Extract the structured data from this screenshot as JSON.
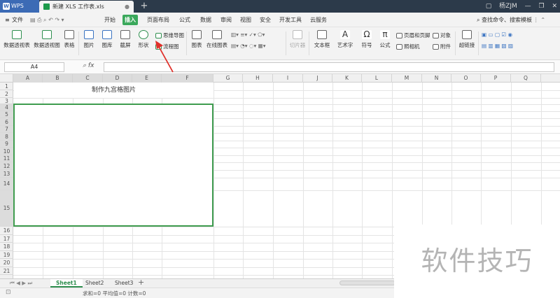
{
  "tabs": {
    "app_name": "WPS",
    "document_title": "新建 XLS 工作表.xls",
    "new_tab": "+"
  },
  "menu": {
    "file": "文件",
    "items": [
      "开始",
      "插入",
      "页面布局",
      "公式",
      "数据",
      "审阅",
      "视图",
      "安全",
      "开发工具",
      "云服务"
    ],
    "active_index": 1,
    "search": "查找命令、搜索模板",
    "user": "杨ZJM"
  },
  "ribbon": {
    "pivot_table": "数据透视表",
    "pivot_chart": "数据透视图",
    "table": "表格",
    "picture": "图片",
    "gallery": "图库",
    "screenshot": "截屏",
    "shapes": "形状",
    "mindmap": "思维导图",
    "flowchart": "流程图",
    "chart": "图表",
    "online_chart": "在线图表",
    "slicer": "切片器",
    "textbox": "文本框",
    "wordart": "艺术字",
    "symbol": "符号",
    "formula": "公式",
    "header_footer": "页眉和页脚",
    "object": "对象",
    "camera": "照相机",
    "attachment": "附件",
    "hyperlink": "超链接"
  },
  "formula_bar": {
    "cell_ref": "A4",
    "fx": "fx",
    "value": ""
  },
  "grid": {
    "columns": [
      "A",
      "B",
      "C",
      "D",
      "E",
      "F",
      "G",
      "H",
      "I",
      "J",
      "K",
      "L",
      "M",
      "N",
      "O",
      "P",
      "Q"
    ],
    "rows": [
      "1",
      "2",
      "3",
      "4",
      "5",
      "6",
      "7",
      "8",
      "9",
      "10",
      "11",
      "12",
      "13",
      "14",
      "15",
      "16",
      "17",
      "18",
      "19",
      "20",
      "21"
    ],
    "title_cell": "制作九宫格图片"
  },
  "sheets": {
    "tabs": [
      "Sheet1",
      "Sheet2",
      "Sheet3"
    ],
    "active_index": 0,
    "add": "+"
  },
  "status": {
    "text": "求和=0  平均值=0  计数=0"
  },
  "watermark": {
    "text": "软件技巧"
  },
  "colors": {
    "accent_green": "#3aa85b",
    "selection_green": "#3f9c4f",
    "arrow_red": "#e0302a",
    "tab_bar": "#2c3a4a"
  }
}
